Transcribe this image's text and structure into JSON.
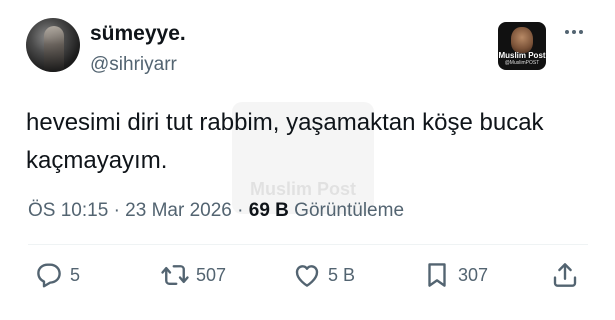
{
  "author": {
    "display_name": "sümeyye.",
    "handle": "@sihriyarr"
  },
  "badge": {
    "title": "Muslim Post",
    "subtitle": "@MuslimPOST"
  },
  "watermark": {
    "text": "Muslim Post"
  },
  "tweet": {
    "text": "hevesimi diri tut rabbim, yaşamaktan köşe bucak kaçmayayım."
  },
  "meta": {
    "time": "ÖS 10:15",
    "separator": "·",
    "date": "23 Mar 2026",
    "views_count": "69 B",
    "views_label": "Görüntüleme"
  },
  "actions": {
    "replies": "5",
    "reposts": "507",
    "likes": "5 B",
    "bookmarks": "307"
  },
  "icons": [
    "reply-icon",
    "repost-icon",
    "like-icon",
    "bookmark-icon",
    "share-icon",
    "more-icon"
  ],
  "colors": {
    "text_primary": "#0f1419",
    "text_secondary": "#536471",
    "divider": "#eff3f4"
  }
}
